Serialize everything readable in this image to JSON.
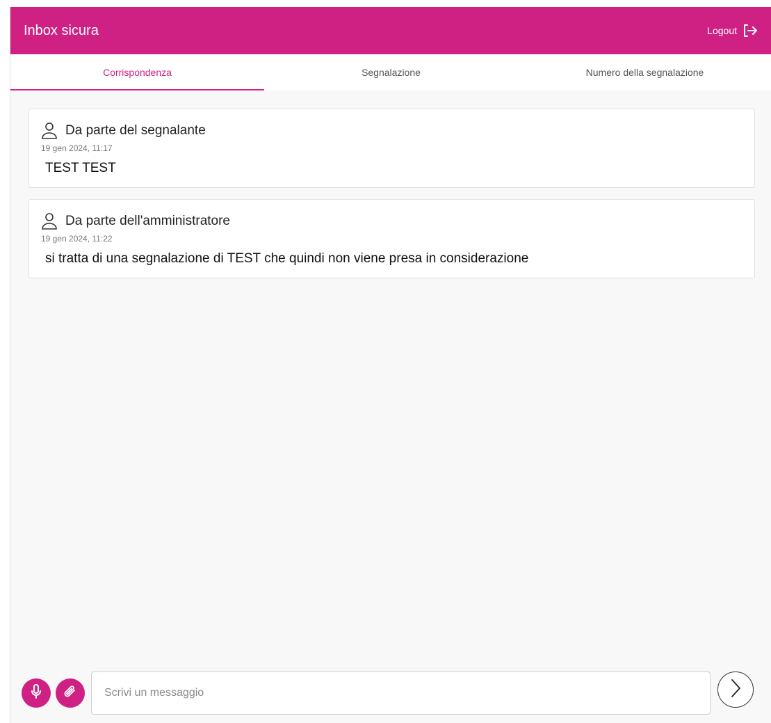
{
  "header": {
    "title": "Inbox sicura",
    "logout_label": "Logout",
    "accent_color": "#cf2184"
  },
  "tabs": [
    {
      "label": "Corrispondenza",
      "active": true
    },
    {
      "label": "Segnalazione",
      "active": false
    },
    {
      "label": "Numero della segnalazione",
      "active": false
    }
  ],
  "messages": [
    {
      "icon": "user-icon",
      "sender": "Da parte del segnalante",
      "time": "19 gen 2024, 11:17",
      "text": "TEST TEST"
    },
    {
      "icon": "user-icon",
      "sender": "Da parte dell'amministratore",
      "time": "19 gen 2024, 11:22",
      "text": "si tratta di una segnalazione di TEST che quindi non viene presa in considerazione"
    }
  ],
  "composer": {
    "placeholder": "Scrivi un messaggio",
    "value": "",
    "mic_icon": "microphone-icon",
    "attach_icon": "paperclip-icon",
    "send_icon": "chevron-right-icon"
  }
}
